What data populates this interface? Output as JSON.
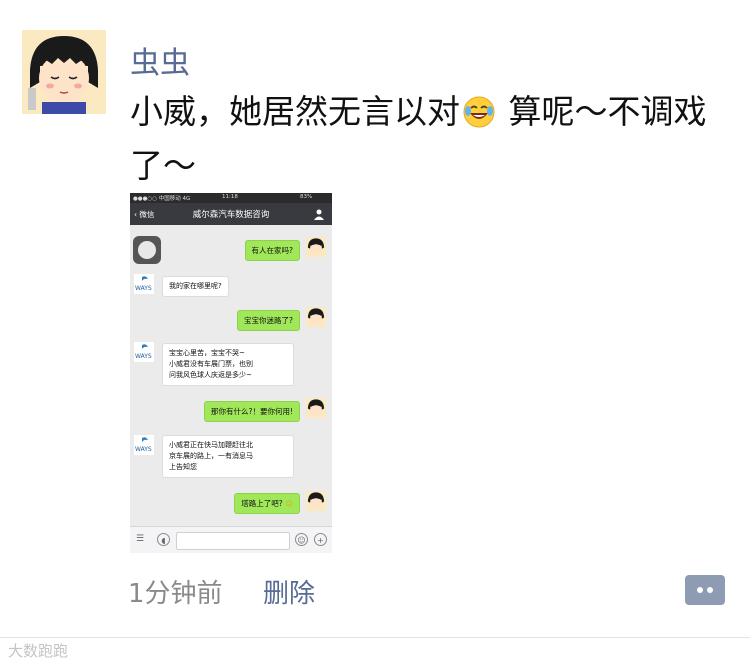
{
  "post": {
    "username": "虫虫",
    "text_before": "小威，她居然无言以对",
    "emoji": "crying-laughing-emoji",
    "text_after": " 算呢～不调戏了～",
    "time": "1分钟前",
    "delete_label": "删除"
  },
  "watermark": "大数跑跑",
  "screenshot": {
    "status_bar": {
      "carrier": "●●●○○ 中国移动 4G",
      "time": "11:18",
      "battery": "83%"
    },
    "nav": {
      "back_label": "微信",
      "title": "威尔森汽车数据咨询",
      "user_icon": "person-icon"
    },
    "bot_logo": "WAYS",
    "messages": [
      {
        "side": "right",
        "text": "有人在家吗?"
      },
      {
        "side": "left",
        "text": "我的家在哪里呢?"
      },
      {
        "side": "right",
        "text": "宝宝你迷路了?"
      },
      {
        "side": "left",
        "lines": [
          "宝宝心里苦，宝宝不哭~",
          "小威君没有车展门票，也别",
          "问我风色球人庆返是多少~"
        ]
      },
      {
        "side": "right",
        "text": "那你有什么?！要你何用!"
      },
      {
        "side": "left",
        "lines": [
          "小威君正在快马加鞭赶往北",
          "京车展的路上，一有消息马",
          "上告知您"
        ]
      },
      {
        "side": "right",
        "text": "塔路上了吧?"
      }
    ]
  },
  "colors": {
    "link": "#576b95",
    "bubble_green": "#a0e75a",
    "nav_bg": "#393a3f"
  }
}
